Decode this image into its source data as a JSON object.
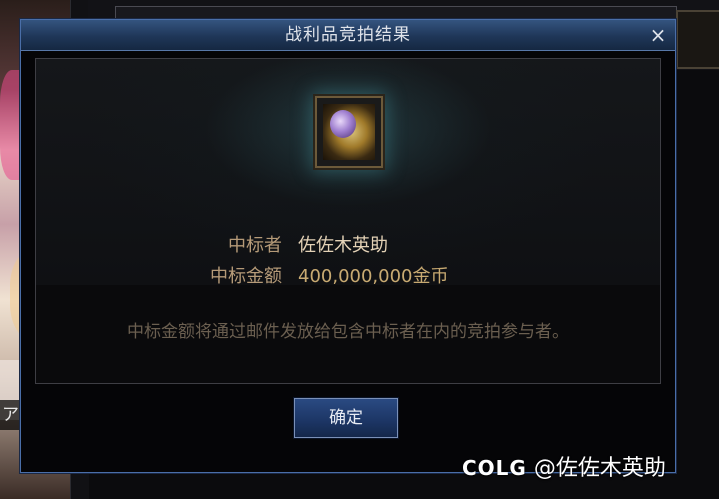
{
  "dialog": {
    "title": "战利品竞拍结果",
    "close_glyph": "×",
    "winner_label": "中标者",
    "winner_value": "佐佐木英助",
    "amount_label": "中标金额",
    "amount_value": "400,000,000金币",
    "notice": "中标金额将通过邮件发放给包含中标者在内的竞拍参与者。",
    "confirm_label": "确定"
  },
  "background": {
    "side_text": "ア天界"
  },
  "watermark": {
    "logo": "COLG",
    "handle": "@佐佐木英助"
  },
  "icons": {
    "close": "close-icon",
    "item": "loot-item-icon"
  },
  "colors": {
    "titlebar": "#1f3658",
    "label": "#b59a78",
    "value": "#e4d2b6",
    "notice": "#6b5f50",
    "button": "#1c3564"
  }
}
